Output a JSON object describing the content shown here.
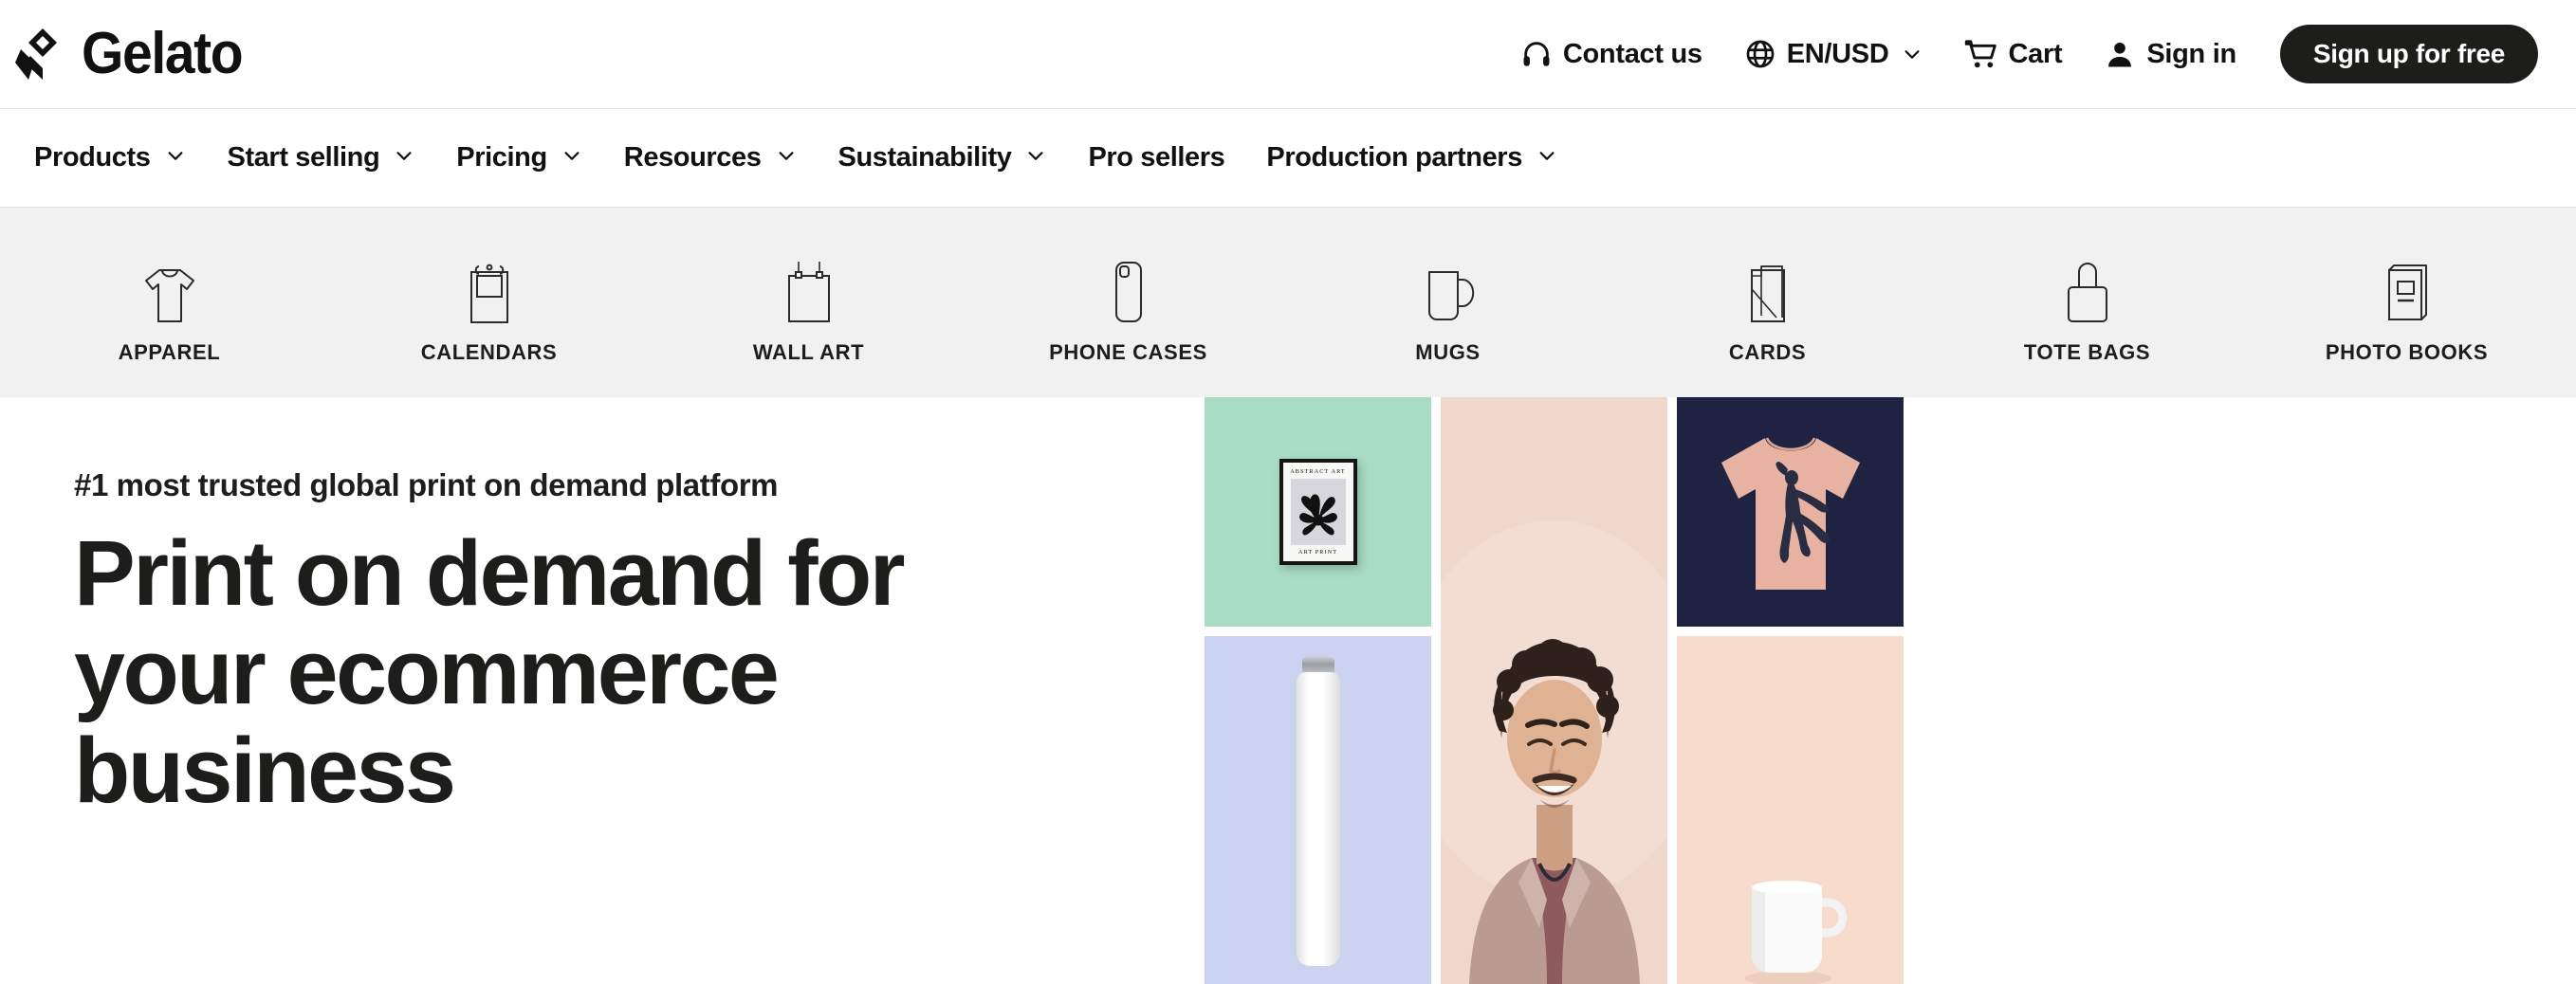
{
  "brand": {
    "name": "Gelato",
    "logo_icon": "gelato-diamond-logo-icon"
  },
  "topbar": {
    "contact": {
      "label": "Contact us",
      "icon": "headset-icon"
    },
    "locale": {
      "label": "EN/USD",
      "icon": "globe-icon",
      "chevron": "chevron-down-icon"
    },
    "cart": {
      "label": "Cart",
      "icon": "shopping-cart-icon"
    },
    "signin": {
      "label": "Sign in",
      "icon": "user-account-icon"
    },
    "signup": {
      "label": "Sign up for free"
    }
  },
  "mainnav": {
    "items": [
      {
        "label": "Products",
        "has_chevron": true
      },
      {
        "label": "Start selling",
        "has_chevron": true
      },
      {
        "label": "Pricing",
        "has_chevron": true
      },
      {
        "label": "Resources",
        "has_chevron": true
      },
      {
        "label": "Sustainability",
        "has_chevron": true
      },
      {
        "label": "Pro sellers",
        "has_chevron": false
      },
      {
        "label": "Production partners",
        "has_chevron": true
      }
    ]
  },
  "categories": [
    {
      "label": "APPAREL",
      "icon": "tshirt-icon"
    },
    {
      "label": "CALENDARS",
      "icon": "calendar-icon"
    },
    {
      "label": "WALL ART",
      "icon": "framed-poster-icon"
    },
    {
      "label": "PHONE CASES",
      "icon": "phone-case-icon"
    },
    {
      "label": "MUGS",
      "icon": "mug-icon"
    },
    {
      "label": "CARDS",
      "icon": "folded-card-icon"
    },
    {
      "label": "TOTE BAGS",
      "icon": "tote-bag-icon"
    },
    {
      "label": "PHOTO BOOKS",
      "icon": "photo-book-icon"
    }
  ],
  "hero": {
    "eyebrow": "#1 most trusted global print on demand platform",
    "headline": "Print on demand for your ecommerce business",
    "gallery": [
      {
        "name": "framed-art-print-tile",
        "background": "#a9dcc4",
        "poster_title": "ABSTRACT ART",
        "poster_caption": "ART PRINT"
      },
      {
        "name": "water-bottle-tile",
        "background": "#ccd3f0"
      },
      {
        "name": "smiling-man-portrait-tile",
        "background": "#f1d8cc"
      },
      {
        "name": "pink-tshirt-dancer-tile",
        "background": "#1e2341"
      },
      {
        "name": "peach-mug-tile",
        "background": "#f7dbcd"
      }
    ]
  },
  "colors": {
    "accent_dark": "#1d1d1b",
    "strip_bg": "#f1f1f1",
    "mint": "#a9dcc4",
    "periwinkle": "#ccd3f0",
    "blush": "#f1d8cc",
    "navy": "#1e2341",
    "peach": "#f7dbcd"
  }
}
